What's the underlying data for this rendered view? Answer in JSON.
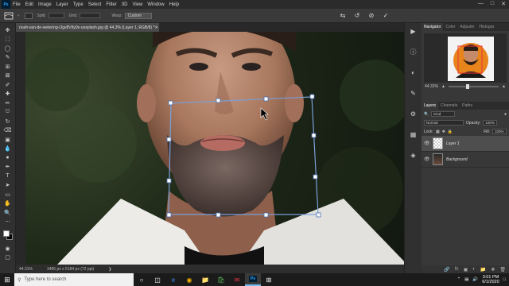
{
  "app": {
    "logo": "Ps"
  },
  "menu": [
    "File",
    "Edit",
    "Image",
    "Layer",
    "Type",
    "Select",
    "Filter",
    "3D",
    "View",
    "Window",
    "Help"
  ],
  "window_controls": [
    "minimize-icon",
    "maximize-icon",
    "close-icon"
  ],
  "options_bar": {
    "split_label": "Split:",
    "grid_label": "Grid:",
    "warp_label": "Warp:",
    "warp_value": "Custom"
  },
  "document": {
    "tab_title": "noah-van-de-wetering-IJgv8VIty0s-unsplash.jpg @ 44.3% (Layer 1, RGB/8) *",
    "zoom": "44.31%",
    "doc_info": "3485 px x 5184 px (72 ppi)"
  },
  "panels": {
    "top_tabs": [
      "Navigator",
      "Color",
      "Adjustm",
      "Histogra"
    ],
    "nav_zoom": "44.31%",
    "nav_zoom_fraction": 0.35,
    "layer_tabs": [
      "Layers",
      "Channels",
      "Paths"
    ],
    "kind_label": "Kind",
    "blend_mode": "Normal",
    "opacity_label": "Opacity:",
    "opacity_value": "100%",
    "lock_label": "Lock:",
    "fill_label": "Fill:",
    "fill_value": "100%",
    "layers": [
      {
        "name": "Layer 1",
        "selected": true
      },
      {
        "name": "Background",
        "selected": false
      }
    ]
  },
  "taskbar": {
    "search_placeholder": "Type here to search",
    "time": "3:01 PM",
    "date": "6/1/2020"
  },
  "colors": {
    "accent": "#31a8ff",
    "foreground_swatch": "#ffffff",
    "background_swatch": "#000000",
    "warp_box": "#7a9fd8"
  }
}
